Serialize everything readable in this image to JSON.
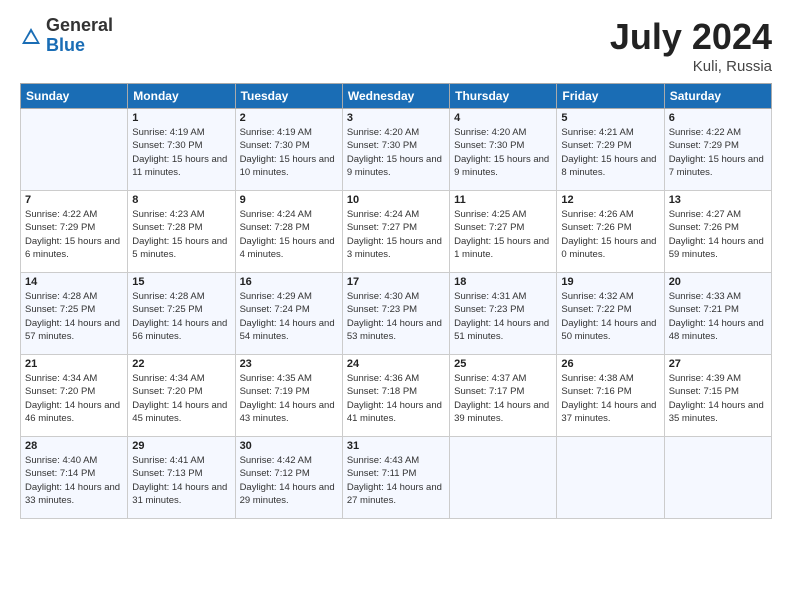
{
  "header": {
    "logo_general": "General",
    "logo_blue": "Blue",
    "month_title": "July 2024",
    "location": "Kuli, Russia"
  },
  "weekdays": [
    "Sunday",
    "Monday",
    "Tuesday",
    "Wednesday",
    "Thursday",
    "Friday",
    "Saturday"
  ],
  "weeks": [
    [
      {
        "day": "",
        "sunrise": "",
        "sunset": "",
        "daylight": ""
      },
      {
        "day": "1",
        "sunrise": "Sunrise: 4:19 AM",
        "sunset": "Sunset: 7:30 PM",
        "daylight": "Daylight: 15 hours and 11 minutes."
      },
      {
        "day": "2",
        "sunrise": "Sunrise: 4:19 AM",
        "sunset": "Sunset: 7:30 PM",
        "daylight": "Daylight: 15 hours and 10 minutes."
      },
      {
        "day": "3",
        "sunrise": "Sunrise: 4:20 AM",
        "sunset": "Sunset: 7:30 PM",
        "daylight": "Daylight: 15 hours and 9 minutes."
      },
      {
        "day": "4",
        "sunrise": "Sunrise: 4:20 AM",
        "sunset": "Sunset: 7:30 PM",
        "daylight": "Daylight: 15 hours and 9 minutes."
      },
      {
        "day": "5",
        "sunrise": "Sunrise: 4:21 AM",
        "sunset": "Sunset: 7:29 PM",
        "daylight": "Daylight: 15 hours and 8 minutes."
      },
      {
        "day": "6",
        "sunrise": "Sunrise: 4:22 AM",
        "sunset": "Sunset: 7:29 PM",
        "daylight": "Daylight: 15 hours and 7 minutes."
      }
    ],
    [
      {
        "day": "7",
        "sunrise": "Sunrise: 4:22 AM",
        "sunset": "Sunset: 7:29 PM",
        "daylight": "Daylight: 15 hours and 6 minutes."
      },
      {
        "day": "8",
        "sunrise": "Sunrise: 4:23 AM",
        "sunset": "Sunset: 7:28 PM",
        "daylight": "Daylight: 15 hours and 5 minutes."
      },
      {
        "day": "9",
        "sunrise": "Sunrise: 4:24 AM",
        "sunset": "Sunset: 7:28 PM",
        "daylight": "Daylight: 15 hours and 4 minutes."
      },
      {
        "day": "10",
        "sunrise": "Sunrise: 4:24 AM",
        "sunset": "Sunset: 7:27 PM",
        "daylight": "Daylight: 15 hours and 3 minutes."
      },
      {
        "day": "11",
        "sunrise": "Sunrise: 4:25 AM",
        "sunset": "Sunset: 7:27 PM",
        "daylight": "Daylight: 15 hours and 1 minute."
      },
      {
        "day": "12",
        "sunrise": "Sunrise: 4:26 AM",
        "sunset": "Sunset: 7:26 PM",
        "daylight": "Daylight: 15 hours and 0 minutes."
      },
      {
        "day": "13",
        "sunrise": "Sunrise: 4:27 AM",
        "sunset": "Sunset: 7:26 PM",
        "daylight": "Daylight: 14 hours and 59 minutes."
      }
    ],
    [
      {
        "day": "14",
        "sunrise": "Sunrise: 4:28 AM",
        "sunset": "Sunset: 7:25 PM",
        "daylight": "Daylight: 14 hours and 57 minutes."
      },
      {
        "day": "15",
        "sunrise": "Sunrise: 4:28 AM",
        "sunset": "Sunset: 7:25 PM",
        "daylight": "Daylight: 14 hours and 56 minutes."
      },
      {
        "day": "16",
        "sunrise": "Sunrise: 4:29 AM",
        "sunset": "Sunset: 7:24 PM",
        "daylight": "Daylight: 14 hours and 54 minutes."
      },
      {
        "day": "17",
        "sunrise": "Sunrise: 4:30 AM",
        "sunset": "Sunset: 7:23 PM",
        "daylight": "Daylight: 14 hours and 53 minutes."
      },
      {
        "day": "18",
        "sunrise": "Sunrise: 4:31 AM",
        "sunset": "Sunset: 7:23 PM",
        "daylight": "Daylight: 14 hours and 51 minutes."
      },
      {
        "day": "19",
        "sunrise": "Sunrise: 4:32 AM",
        "sunset": "Sunset: 7:22 PM",
        "daylight": "Daylight: 14 hours and 50 minutes."
      },
      {
        "day": "20",
        "sunrise": "Sunrise: 4:33 AM",
        "sunset": "Sunset: 7:21 PM",
        "daylight": "Daylight: 14 hours and 48 minutes."
      }
    ],
    [
      {
        "day": "21",
        "sunrise": "Sunrise: 4:34 AM",
        "sunset": "Sunset: 7:20 PM",
        "daylight": "Daylight: 14 hours and 46 minutes."
      },
      {
        "day": "22",
        "sunrise": "Sunrise: 4:34 AM",
        "sunset": "Sunset: 7:20 PM",
        "daylight": "Daylight: 14 hours and 45 minutes."
      },
      {
        "day": "23",
        "sunrise": "Sunrise: 4:35 AM",
        "sunset": "Sunset: 7:19 PM",
        "daylight": "Daylight: 14 hours and 43 minutes."
      },
      {
        "day": "24",
        "sunrise": "Sunrise: 4:36 AM",
        "sunset": "Sunset: 7:18 PM",
        "daylight": "Daylight: 14 hours and 41 minutes."
      },
      {
        "day": "25",
        "sunrise": "Sunrise: 4:37 AM",
        "sunset": "Sunset: 7:17 PM",
        "daylight": "Daylight: 14 hours and 39 minutes."
      },
      {
        "day": "26",
        "sunrise": "Sunrise: 4:38 AM",
        "sunset": "Sunset: 7:16 PM",
        "daylight": "Daylight: 14 hours and 37 minutes."
      },
      {
        "day": "27",
        "sunrise": "Sunrise: 4:39 AM",
        "sunset": "Sunset: 7:15 PM",
        "daylight": "Daylight: 14 hours and 35 minutes."
      }
    ],
    [
      {
        "day": "28",
        "sunrise": "Sunrise: 4:40 AM",
        "sunset": "Sunset: 7:14 PM",
        "daylight": "Daylight: 14 hours and 33 minutes."
      },
      {
        "day": "29",
        "sunrise": "Sunrise: 4:41 AM",
        "sunset": "Sunset: 7:13 PM",
        "daylight": "Daylight: 14 hours and 31 minutes."
      },
      {
        "day": "30",
        "sunrise": "Sunrise: 4:42 AM",
        "sunset": "Sunset: 7:12 PM",
        "daylight": "Daylight: 14 hours and 29 minutes."
      },
      {
        "day": "31",
        "sunrise": "Sunrise: 4:43 AM",
        "sunset": "Sunset: 7:11 PM",
        "daylight": "Daylight: 14 hours and 27 minutes."
      },
      {
        "day": "",
        "sunrise": "",
        "sunset": "",
        "daylight": ""
      },
      {
        "day": "",
        "sunrise": "",
        "sunset": "",
        "daylight": ""
      },
      {
        "day": "",
        "sunrise": "",
        "sunset": "",
        "daylight": ""
      }
    ]
  ]
}
